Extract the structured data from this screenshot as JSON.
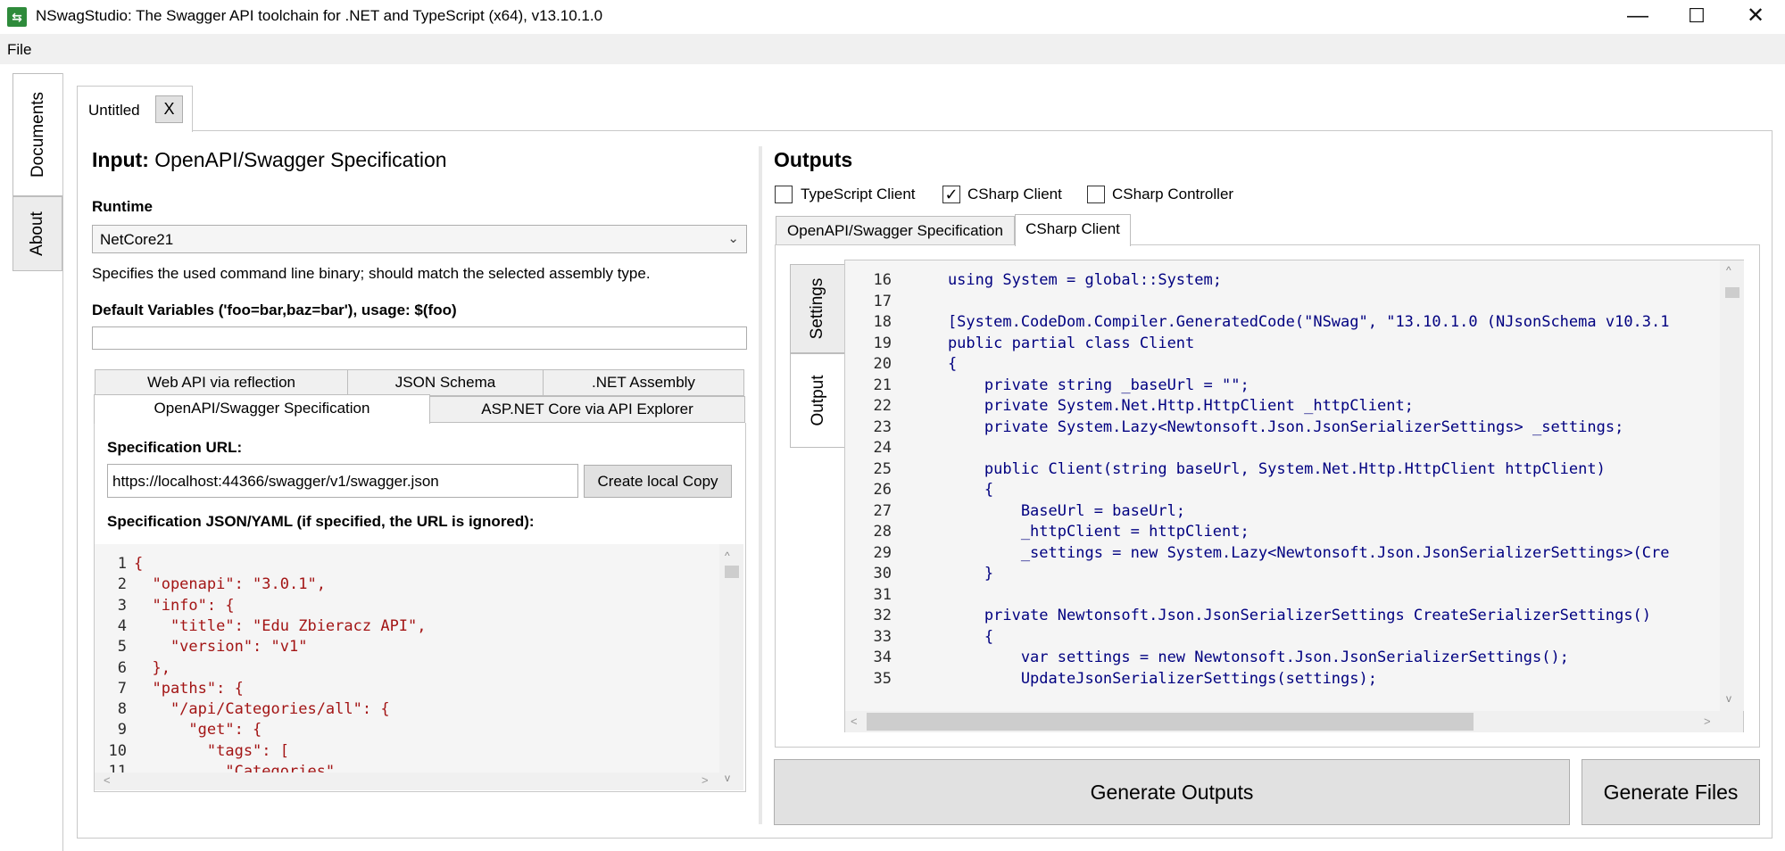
{
  "window": {
    "title": "NSwagStudio: The Swagger API toolchain for .NET and TypeScript (x64), v13.10.1.0",
    "icon": "nswag-app-icon",
    "controls": {
      "minimize": "—",
      "maximize": "☐",
      "close": "✕"
    }
  },
  "menu": {
    "file": "File"
  },
  "side_tabs": {
    "documents": "Documents",
    "about": "About"
  },
  "doc_tab": {
    "label": "Untitled",
    "close": "X"
  },
  "input": {
    "heading_bold": "Input:",
    "heading_rest": " OpenAPI/Swagger Specification",
    "runtime_label": "Runtime",
    "runtime_value": "NetCore21",
    "runtime_hint": "Specifies the used command line binary; should match the selected assembly type.",
    "default_vars_label": "Default Variables ('foo=bar,baz=bar'), usage: $(foo)",
    "default_vars_value": "",
    "tabs_row1": [
      "Web API via reflection",
      "JSON Schema",
      ".NET Assembly"
    ],
    "tabs_row2": [
      "OpenAPI/Swagger Specification",
      "ASP.NET Core via API Explorer"
    ],
    "spec_url_label": "Specification URL:",
    "spec_url_value": "https://localhost:44366/swagger/v1/swagger.json",
    "create_copy_button": "Create local Copy",
    "spec_json_label": "Specification JSON/YAML (if specified, the URL is ignored):",
    "json_lines": [
      {
        "n": "1",
        "text": "{"
      },
      {
        "n": "2",
        "text": "  \"openapi\": \"3.0.1\","
      },
      {
        "n": "3",
        "text": "  \"info\": {"
      },
      {
        "n": "4",
        "text": "    \"title\": \"Edu Zbieracz API\","
      },
      {
        "n": "5",
        "text": "    \"version\": \"v1\""
      },
      {
        "n": "6",
        "text": "  },"
      },
      {
        "n": "7",
        "text": "  \"paths\": {"
      },
      {
        "n": "8",
        "text": "    \"/api/Categories/all\": {"
      },
      {
        "n": "9",
        "text": "      \"get\": {"
      },
      {
        "n": "10",
        "text": "        \"tags\": ["
      },
      {
        "n": "11",
        "text": "          \"Categories\""
      }
    ]
  },
  "outputs": {
    "heading": "Outputs",
    "checkboxes": [
      {
        "label": "TypeScript Client",
        "checked": false
      },
      {
        "label": "CSharp Client",
        "checked": true
      },
      {
        "label": "CSharp Controller",
        "checked": false
      }
    ],
    "tabs": [
      "OpenAPI/Swagger Specification",
      "CSharp Client"
    ],
    "side_tabs": [
      "Settings",
      "Output"
    ],
    "code_lines": [
      {
        "n": "16",
        "text": "    using System = global::System;"
      },
      {
        "n": "17",
        "text": ""
      },
      {
        "n": "18",
        "text": "    [System.CodeDom.Compiler.GeneratedCode(\"NSwag\", \"13.10.1.0 (NJsonSchema v10.3.1"
      },
      {
        "n": "19",
        "text": "    public partial class Client"
      },
      {
        "n": "20",
        "text": "    {"
      },
      {
        "n": "21",
        "text": "        private string _baseUrl = \"\";"
      },
      {
        "n": "22",
        "text": "        private System.Net.Http.HttpClient _httpClient;"
      },
      {
        "n": "23",
        "text": "        private System.Lazy<Newtonsoft.Json.JsonSerializerSettings> _settings;"
      },
      {
        "n": "24",
        "text": ""
      },
      {
        "n": "25",
        "text": "        public Client(string baseUrl, System.Net.Http.HttpClient httpClient)"
      },
      {
        "n": "26",
        "text": "        {"
      },
      {
        "n": "27",
        "text": "            BaseUrl = baseUrl;"
      },
      {
        "n": "28",
        "text": "            _httpClient = httpClient;"
      },
      {
        "n": "29",
        "text": "            _settings = new System.Lazy<Newtonsoft.Json.JsonSerializerSettings>(Cre"
      },
      {
        "n": "30",
        "text": "        }"
      },
      {
        "n": "31",
        "text": ""
      },
      {
        "n": "32",
        "text": "        private Newtonsoft.Json.JsonSerializerSettings CreateSerializerSettings()"
      },
      {
        "n": "33",
        "text": "        {"
      },
      {
        "n": "34",
        "text": "            var settings = new Newtonsoft.Json.JsonSerializerSettings();"
      },
      {
        "n": "35",
        "text": "            UpdateJsonSerializerSettings(settings);"
      }
    ],
    "generate_outputs_button": "Generate Outputs",
    "generate_files_button": "Generate Files"
  },
  "colors": {
    "keyword": "#0000ff",
    "type": "#2b91af",
    "green_keyword": "#008000",
    "string": "#a31515",
    "app_icon": "#2e8b3b"
  }
}
